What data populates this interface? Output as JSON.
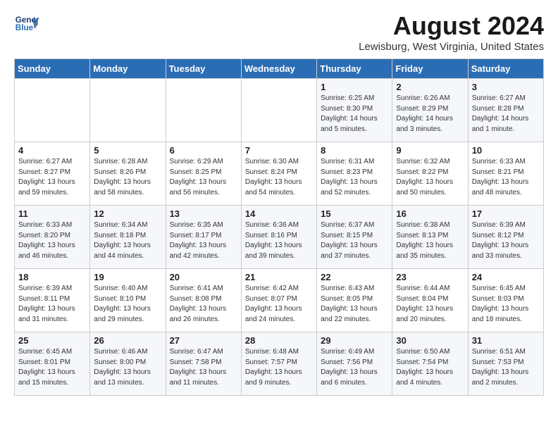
{
  "header": {
    "logo_line1": "General",
    "logo_line2": "Blue",
    "month_year": "August 2024",
    "location": "Lewisburg, West Virginia, United States"
  },
  "days_of_week": [
    "Sunday",
    "Monday",
    "Tuesday",
    "Wednesday",
    "Thursday",
    "Friday",
    "Saturday"
  ],
  "weeks": [
    [
      {
        "day": "",
        "info": ""
      },
      {
        "day": "",
        "info": ""
      },
      {
        "day": "",
        "info": ""
      },
      {
        "day": "",
        "info": ""
      },
      {
        "day": "1",
        "info": "Sunrise: 6:25 AM\nSunset: 8:30 PM\nDaylight: 14 hours\nand 5 minutes."
      },
      {
        "day": "2",
        "info": "Sunrise: 6:26 AM\nSunset: 8:29 PM\nDaylight: 14 hours\nand 3 minutes."
      },
      {
        "day": "3",
        "info": "Sunrise: 6:27 AM\nSunset: 8:28 PM\nDaylight: 14 hours\nand 1 minute."
      }
    ],
    [
      {
        "day": "4",
        "info": "Sunrise: 6:27 AM\nSunset: 8:27 PM\nDaylight: 13 hours\nand 59 minutes."
      },
      {
        "day": "5",
        "info": "Sunrise: 6:28 AM\nSunset: 8:26 PM\nDaylight: 13 hours\nand 58 minutes."
      },
      {
        "day": "6",
        "info": "Sunrise: 6:29 AM\nSunset: 8:25 PM\nDaylight: 13 hours\nand 56 minutes."
      },
      {
        "day": "7",
        "info": "Sunrise: 6:30 AM\nSunset: 8:24 PM\nDaylight: 13 hours\nand 54 minutes."
      },
      {
        "day": "8",
        "info": "Sunrise: 6:31 AM\nSunset: 8:23 PM\nDaylight: 13 hours\nand 52 minutes."
      },
      {
        "day": "9",
        "info": "Sunrise: 6:32 AM\nSunset: 8:22 PM\nDaylight: 13 hours\nand 50 minutes."
      },
      {
        "day": "10",
        "info": "Sunrise: 6:33 AM\nSunset: 8:21 PM\nDaylight: 13 hours\nand 48 minutes."
      }
    ],
    [
      {
        "day": "11",
        "info": "Sunrise: 6:33 AM\nSunset: 8:20 PM\nDaylight: 13 hours\nand 46 minutes."
      },
      {
        "day": "12",
        "info": "Sunrise: 6:34 AM\nSunset: 8:18 PM\nDaylight: 13 hours\nand 44 minutes."
      },
      {
        "day": "13",
        "info": "Sunrise: 6:35 AM\nSunset: 8:17 PM\nDaylight: 13 hours\nand 42 minutes."
      },
      {
        "day": "14",
        "info": "Sunrise: 6:36 AM\nSunset: 8:16 PM\nDaylight: 13 hours\nand 39 minutes."
      },
      {
        "day": "15",
        "info": "Sunrise: 6:37 AM\nSunset: 8:15 PM\nDaylight: 13 hours\nand 37 minutes."
      },
      {
        "day": "16",
        "info": "Sunrise: 6:38 AM\nSunset: 8:13 PM\nDaylight: 13 hours\nand 35 minutes."
      },
      {
        "day": "17",
        "info": "Sunrise: 6:39 AM\nSunset: 8:12 PM\nDaylight: 13 hours\nand 33 minutes."
      }
    ],
    [
      {
        "day": "18",
        "info": "Sunrise: 6:39 AM\nSunset: 8:11 PM\nDaylight: 13 hours\nand 31 minutes."
      },
      {
        "day": "19",
        "info": "Sunrise: 6:40 AM\nSunset: 8:10 PM\nDaylight: 13 hours\nand 29 minutes."
      },
      {
        "day": "20",
        "info": "Sunrise: 6:41 AM\nSunset: 8:08 PM\nDaylight: 13 hours\nand 26 minutes."
      },
      {
        "day": "21",
        "info": "Sunrise: 6:42 AM\nSunset: 8:07 PM\nDaylight: 13 hours\nand 24 minutes."
      },
      {
        "day": "22",
        "info": "Sunrise: 6:43 AM\nSunset: 8:05 PM\nDaylight: 13 hours\nand 22 minutes."
      },
      {
        "day": "23",
        "info": "Sunrise: 6:44 AM\nSunset: 8:04 PM\nDaylight: 13 hours\nand 20 minutes."
      },
      {
        "day": "24",
        "info": "Sunrise: 6:45 AM\nSunset: 8:03 PM\nDaylight: 13 hours\nand 18 minutes."
      }
    ],
    [
      {
        "day": "25",
        "info": "Sunrise: 6:45 AM\nSunset: 8:01 PM\nDaylight: 13 hours\nand 15 minutes."
      },
      {
        "day": "26",
        "info": "Sunrise: 6:46 AM\nSunset: 8:00 PM\nDaylight: 13 hours\nand 13 minutes."
      },
      {
        "day": "27",
        "info": "Sunrise: 6:47 AM\nSunset: 7:58 PM\nDaylight: 13 hours\nand 11 minutes."
      },
      {
        "day": "28",
        "info": "Sunrise: 6:48 AM\nSunset: 7:57 PM\nDaylight: 13 hours\nand 9 minutes."
      },
      {
        "day": "29",
        "info": "Sunrise: 6:49 AM\nSunset: 7:56 PM\nDaylight: 13 hours\nand 6 minutes."
      },
      {
        "day": "30",
        "info": "Sunrise: 6:50 AM\nSunset: 7:54 PM\nDaylight: 13 hours\nand 4 minutes."
      },
      {
        "day": "31",
        "info": "Sunrise: 6:51 AM\nSunset: 7:53 PM\nDaylight: 13 hours\nand 2 minutes."
      }
    ]
  ]
}
